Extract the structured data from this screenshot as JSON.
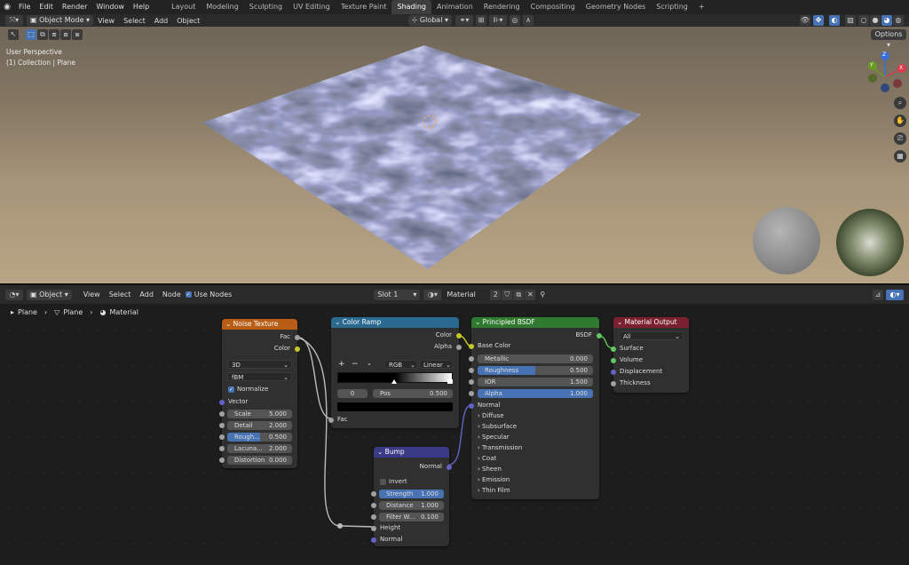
{
  "topbar": {
    "menus": [
      "File",
      "Edit",
      "Render",
      "Window",
      "Help"
    ],
    "workspaces": [
      "Layout",
      "Modeling",
      "Sculpting",
      "UV Editing",
      "Texture Paint",
      "Shading",
      "Animation",
      "Rendering",
      "Compositing",
      "Geometry Nodes",
      "Scripting"
    ],
    "active_workspace": "Shading",
    "add_tab": "+"
  },
  "viewport_header": {
    "mode": "Object Mode",
    "menus": [
      "View",
      "Select",
      "Add",
      "Object"
    ],
    "orientation": "Global",
    "options": "Options"
  },
  "viewport": {
    "perspective": "User Perspective",
    "collection": "(1) Collection | Plane",
    "gizmo": {
      "x": "X",
      "y": "Y",
      "z": "Z"
    }
  },
  "node_header": {
    "editor_type": "Object",
    "menus": [
      "View",
      "Select",
      "Add",
      "Node"
    ],
    "use_nodes": "Use Nodes",
    "slot": "Slot 1",
    "material": "Material",
    "users": "2"
  },
  "breadcrumb": [
    "Plane",
    "Plane",
    "Material"
  ],
  "noise": {
    "title": "Noise Texture",
    "out_fac": "Fac",
    "out_color": "Color",
    "dim": "3D",
    "type": "fBM",
    "normalize": "Normalize",
    "vector": "Vector",
    "fields": [
      {
        "label": "Scale",
        "value": "5.000"
      },
      {
        "label": "Detail",
        "value": "2.000"
      },
      {
        "label": "Rough...",
        "value": "0.500"
      },
      {
        "label": "Lacuna...",
        "value": "2.000"
      },
      {
        "label": "Distortion",
        "value": "0.000"
      }
    ]
  },
  "ramp": {
    "title": "Color Ramp",
    "out_color": "Color",
    "out_alpha": "Alpha",
    "plus": "+",
    "minus": "−",
    "mode": "RGB",
    "interp": "Linear",
    "index": "0",
    "pos_label": "Pos",
    "pos_value": "0.500",
    "in_fac": "Fac"
  },
  "bsdf": {
    "title": "Principled BSDF",
    "out": "BSDF",
    "base_color": "Base Color",
    "fields": [
      {
        "label": "Metallic",
        "value": "0.000"
      },
      {
        "label": "Roughness",
        "value": "0.500"
      },
      {
        "label": "IOR",
        "value": "1.500"
      },
      {
        "label": "Alpha",
        "value": "1.000"
      }
    ],
    "roughness_level": 0.5,
    "normal": "Normal",
    "panels": [
      "Diffuse",
      "Subsurface",
      "Specular",
      "Transmission",
      "Coat",
      "Sheen",
      "Emission",
      "Thin Film"
    ]
  },
  "output": {
    "title": "Material Output",
    "target": "All",
    "inputs": [
      "Surface",
      "Volume",
      "Displacement",
      "Thickness"
    ]
  },
  "bump": {
    "title": "Bump",
    "out": "Normal",
    "invert": "Invert",
    "fields": [
      {
        "label": "Strength",
        "value": "1.000"
      },
      {
        "label": "Distance",
        "value": "1.000"
      },
      {
        "label": "Filter W...",
        "value": "0.100"
      }
    ],
    "in_height": "Height",
    "in_normal": "Normal"
  },
  "colors": {
    "noise_header": "#b85c16",
    "ramp_header": "#2a6a90",
    "bsdf_header": "#2f7a2f",
    "output_header": "#7a2030",
    "bump_header": "#3a3a86",
    "accent": "#4772b3"
  }
}
